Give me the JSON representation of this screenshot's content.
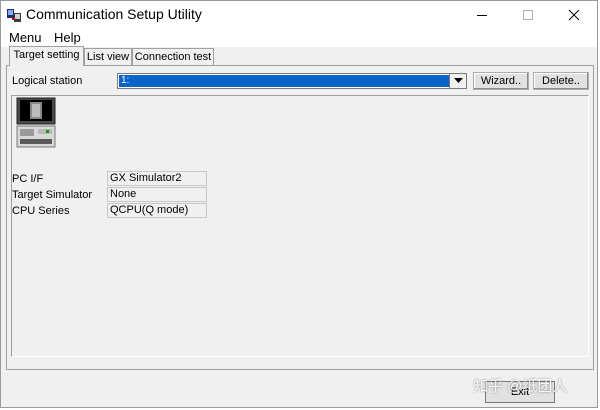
{
  "window": {
    "title": "Communication Setup Utility",
    "controls": {
      "minimize": "minimize-icon",
      "maximize": "maximize-icon",
      "close": "close-icon"
    }
  },
  "menubar": {
    "items": [
      {
        "label": "Menu"
      },
      {
        "label": "Help"
      }
    ]
  },
  "tabs": [
    {
      "label": "Target setting",
      "active": true
    },
    {
      "label": "List view",
      "active": false
    },
    {
      "label": "Connection test",
      "active": false
    }
  ],
  "target_setting": {
    "logical_station_label": "Logical station",
    "logical_station_value": "1:",
    "wizard_label": "Wizard..",
    "delete_label": "Delete..",
    "fields": [
      {
        "label": "PC I/F",
        "value": "GX Simulator2"
      },
      {
        "label": "Target Simulator",
        "value": "None"
      },
      {
        "label": "CPU Series",
        "value": "QCPU(Q mode)"
      }
    ]
  },
  "footer": {
    "exit_label": "Exit",
    "watermark": "知乎 @纸团人"
  },
  "colors": {
    "accent": "#0a64c8",
    "window_bg": "#f0f0f0"
  }
}
